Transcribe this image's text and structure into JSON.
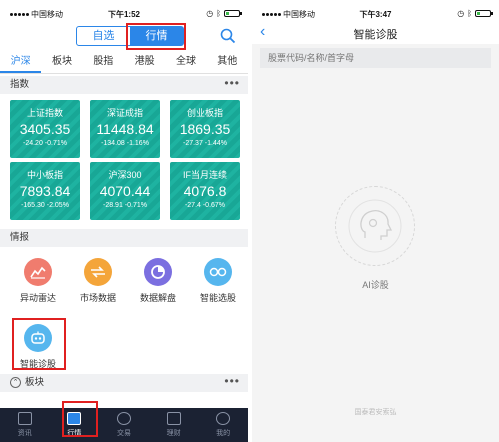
{
  "left": {
    "status": {
      "carrier": "中国移动",
      "time": "下午1:52",
      "battery_pct": 25
    },
    "header": {
      "segments": [
        {
          "label": "自选",
          "active": false
        },
        {
          "label": "行情",
          "active": true
        }
      ]
    },
    "tabs": [
      {
        "label": "沪深",
        "active": true
      },
      {
        "label": "板块",
        "active": false
      },
      {
        "label": "股指",
        "active": false
      },
      {
        "label": "港股",
        "active": false
      },
      {
        "label": "全球",
        "active": false
      },
      {
        "label": "其他",
        "active": false
      }
    ],
    "index_section": {
      "title": "指数",
      "more": "•••"
    },
    "indices": [
      {
        "name": "上证指数",
        "value": "3405.35",
        "change": "-24.20  -0.71%"
      },
      {
        "name": "深证成指",
        "value": "11448.84",
        "change": "-134.08  -1.16%"
      },
      {
        "name": "创业板指",
        "value": "1869.35",
        "change": "-27.37  -1.44%"
      },
      {
        "name": "中小板指",
        "value": "7893.84",
        "change": "-165.30  -2.05%"
      },
      {
        "name": "沪深300",
        "value": "4070.44",
        "change": "-28.91  -0.71%"
      },
      {
        "name": "IF当月连续",
        "value": "4076.8",
        "change": "-27.4  -0.67%"
      }
    ],
    "intel_section": {
      "title": "情报"
    },
    "features": [
      {
        "label": "异动雷达",
        "icon": "radar-icon",
        "color": "#f07c6e"
      },
      {
        "label": "市场数据",
        "icon": "arrows-icon",
        "color": "#f4a53a"
      },
      {
        "label": "数据解盘",
        "icon": "pie-chart-icon",
        "color": "#7b6fe0"
      },
      {
        "label": "智能选股",
        "icon": "glasses-icon",
        "color": "#56b6ee"
      },
      {
        "label": "智能诊股",
        "icon": "robot-icon",
        "color": "#56b6ee"
      }
    ],
    "board_section": {
      "title": "板块",
      "more": "•••"
    },
    "nav": [
      {
        "label": "资讯",
        "active": false
      },
      {
        "label": "行情",
        "active": true
      },
      {
        "label": "交易",
        "active": false
      },
      {
        "label": "理财",
        "active": false
      },
      {
        "label": "我的",
        "active": false
      }
    ]
  },
  "right": {
    "status": {
      "carrier": "中国移动",
      "time": "下午3:47",
      "battery_pct": 25
    },
    "title": "智能诊股",
    "search_placeholder": "股票代码/名称/首字母",
    "ai_label": "AI诊股",
    "footer": "国泰君安索弘"
  }
}
